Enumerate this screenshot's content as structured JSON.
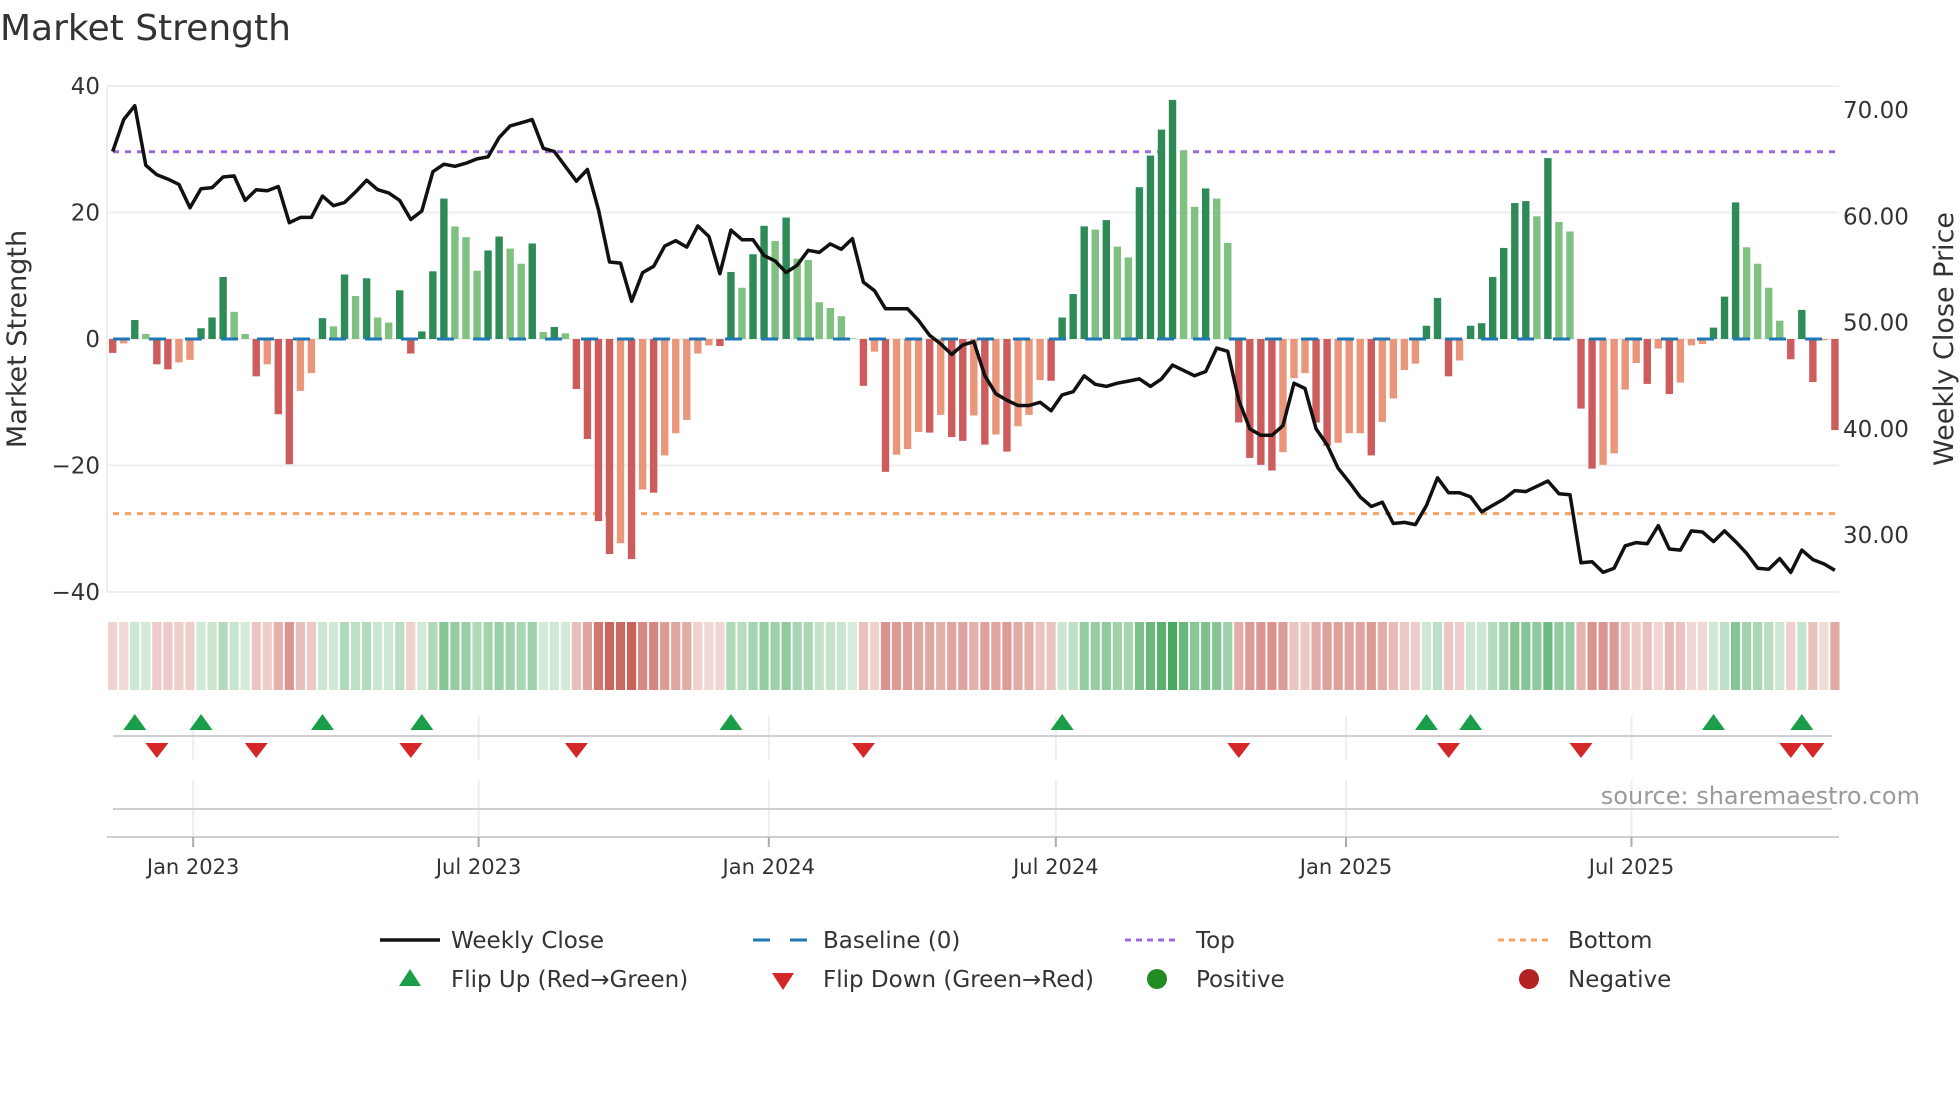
{
  "chart_data": {
    "type": "bar",
    "title": "Market Strength",
    "ylabel": "Market Strength",
    "ylabel_right": "Weekly Close Price",
    "ylim": [
      -40,
      40
    ],
    "ylim_right": [
      24.5,
      72
    ],
    "x_start": "2022-11-11",
    "x_frequency": "weekly",
    "yticks": [
      {
        "value": 40,
        "label": "40"
      },
      {
        "value": 20,
        "label": "20"
      },
      {
        "value": 0,
        "label": "0"
      },
      {
        "value": -20,
        "label": "−20"
      },
      {
        "value": -40,
        "label": "−40"
      }
    ],
    "yticks_right": [
      {
        "value": 70,
        "label": "70.00"
      },
      {
        "value": 60,
        "label": "60.00"
      },
      {
        "value": 50,
        "label": "50.00"
      },
      {
        "value": 40,
        "label": "40.00"
      },
      {
        "value": 30,
        "label": "30.00"
      }
    ],
    "xticks": [
      {
        "date": "2023-01-01",
        "label": "Jan 2023"
      },
      {
        "date": "2023-07-01",
        "label": "Jul 2023"
      },
      {
        "date": "2024-01-01",
        "label": "Jan 2024"
      },
      {
        "date": "2024-07-01",
        "label": "Jul 2024"
      },
      {
        "date": "2025-01-01",
        "label": "Jan 2025"
      },
      {
        "date": "2025-07-01",
        "label": "Jul 2025"
      }
    ],
    "top_level": 29.6,
    "bottom_level": -27.6,
    "baseline": 0,
    "strength": [
      -2.2,
      -0.7,
      3.0,
      0.8,
      -4.0,
      -4.8,
      -3.7,
      -3.3,
      1.7,
      3.4,
      9.8,
      4.3,
      0.8,
      -5.9,
      -4.0,
      -11.9,
      -19.8,
      -8.2,
      -5.4,
      3.3,
      2.0,
      10.2,
      6.8,
      9.6,
      3.4,
      2.6,
      7.7,
      -2.3,
      1.2,
      10.7,
      22.2,
      17.8,
      16.1,
      10.8,
      14.0,
      16.2,
      14.3,
      11.9,
      15.1,
      1.1,
      1.9,
      0.9,
      -7.9,
      -15.8,
      -28.8,
      -34.0,
      -32.3,
      -34.8,
      -23.8,
      -24.3,
      -18.4,
      -14.9,
      -12.8,
      -2.3,
      -1.0,
      -1.1,
      10.6,
      8.1,
      13.4,
      17.9,
      15.5,
      19.2,
      12.7,
      12.5,
      5.8,
      4.9,
      3.6,
      0.1,
      -7.4,
      -2.0,
      -21.0,
      -18.3,
      -17.4,
      -14.7,
      -14.8,
      -12.0,
      -15.5,
      -16.1,
      -12.1,
      -16.7,
      -15.1,
      -17.8,
      -13.8,
      -12.0,
      -6.5,
      -6.6,
      3.4,
      7.1,
      17.8,
      17.3,
      18.8,
      14.6,
      12.9,
      24.0,
      29.0,
      33.1,
      37.8,
      29.8,
      20.9,
      23.8,
      22.2,
      15.2,
      -13.2,
      -18.8,
      -19.9,
      -20.8,
      -17.9,
      -6.2,
      -5.4,
      -13.2,
      -16.9,
      -16.4,
      -14.9,
      -14.9,
      -18.4,
      -13.1,
      -9.4,
      -4.9,
      -3.9,
      2.1,
      6.5,
      -5.9,
      -3.4,
      2.1,
      2.5,
      9.8,
      14.4,
      21.5,
      21.8,
      19.4,
      28.6,
      18.5,
      17.0,
      -11.0,
      -20.5,
      -19.9,
      -18.1,
      -8.0,
      -3.8,
      -7.1,
      -1.5,
      -8.7,
      -6.9,
      -1.0,
      -0.8,
      1.8,
      6.7,
      21.6,
      14.5,
      11.9,
      8.1,
      2.9,
      -3.2,
      4.6,
      -6.8,
      -0.2,
      -14.4
    ],
    "weekly_close": [
      66.1,
      69.1,
      70.4,
      64.8,
      63.9,
      63.5,
      63.0,
      60.8,
      62.6,
      62.7,
      63.7,
      63.8,
      61.5,
      62.5,
      62.4,
      62.8,
      59.4,
      59.9,
      59.9,
      61.9,
      61.0,
      61.3,
      62.3,
      63.4,
      62.5,
      62.2,
      61.5,
      59.7,
      60.5,
      64.2,
      64.9,
      64.7,
      65.0,
      65.4,
      65.6,
      67.4,
      68.5,
      68.8,
      69.1,
      66.4,
      66.1,
      64.7,
      63.3,
      64.4,
      60.6,
      55.7,
      55.6,
      52.0,
      54.7,
      55.3,
      57.2,
      57.7,
      57.1,
      59.1,
      58.1,
      54.6,
      58.7,
      57.8,
      57.8,
      56.3,
      55.8,
      54.7,
      55.4,
      56.8,
      56.6,
      57.4,
      56.9,
      57.9,
      53.8,
      53.0,
      51.3,
      51.3,
      51.3,
      50.2,
      48.8,
      48.0,
      47.0,
      47.9,
      48.2,
      45.0,
      43.3,
      42.7,
      42.2,
      42.2,
      42.5,
      41.7,
      43.2,
      43.5,
      45.0,
      44.2,
      44.0,
      44.3,
      44.5,
      44.7,
      44.0,
      44.7,
      46.0,
      45.5,
      45.0,
      45.4,
      47.6,
      47.3,
      42.7,
      40.0,
      39.4,
      39.4,
      40.3,
      44.3,
      43.8,
      40.0,
      38.5,
      36.3,
      35.0,
      33.6,
      32.7,
      33.1,
      31.1,
      31.2,
      31.0,
      32.8,
      35.4,
      34.0,
      34.0,
      33.6,
      32.2,
      32.8,
      33.4,
      34.2,
      34.1,
      34.6,
      35.1,
      33.9,
      33.8,
      27.4,
      27.5,
      26.5,
      26.9,
      29.0,
      29.3,
      29.2,
      30.9,
      28.7,
      28.6,
      30.4,
      30.3,
      29.4,
      30.4,
      29.4,
      28.3,
      26.9,
      26.8,
      27.8,
      26.5,
      28.6,
      27.7,
      27.3,
      26.7
    ],
    "legend": {
      "placement": "bottom-center",
      "items": [
        {
          "key": "close",
          "label": "Weekly Close"
        },
        {
          "key": "baseline",
          "label": "Baseline (0)"
        },
        {
          "key": "top",
          "label": "Top"
        },
        {
          "key": "bottom",
          "label": "Bottom"
        },
        {
          "key": "flip_up",
          "label": "Flip Up (Red→Green)"
        },
        {
          "key": "flip_down",
          "label": "Flip Down (Green→Red)"
        },
        {
          "key": "positive",
          "label": "Positive"
        },
        {
          "key": "negative",
          "label": "Negative"
        }
      ]
    },
    "colors": {
      "pos_rising": "#2e8b57",
      "pos_falling": "#80c080",
      "neg_falling": "#cd5c5c",
      "neg_rising": "#e9967a",
      "close": "#111111",
      "baseline": "#1f77b4",
      "top": "#9b6ddb",
      "bottom": "#f4a460",
      "flip_up": "#1a9e4a",
      "flip_down": "#d62728",
      "positive_dot": "#228b22",
      "negative_dot": "#b22222",
      "heat_pos": "#4aa860",
      "heat_neg": "#c4584e",
      "grid": "#eceef2"
    },
    "grid": true
  },
  "source": "source: sharemaestro.com"
}
